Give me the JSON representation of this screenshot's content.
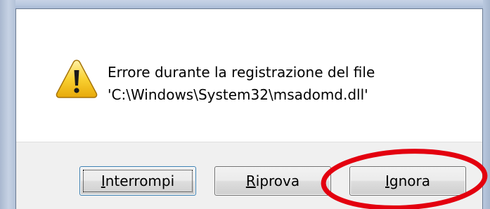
{
  "dialog": {
    "message_line1": "Errore durante la registrazione del file",
    "message_line2": "'C:\\Windows\\System32\\msadomd.dll'",
    "icon": "warning-icon"
  },
  "buttons": {
    "interrompi": {
      "accel": "I",
      "rest": "nterrompi",
      "label": "Interrompi"
    },
    "riprova": {
      "accel": "R",
      "rest": "iprova",
      "label": "Riprova"
    },
    "ignora": {
      "accel": "I",
      "rest": "gnora",
      "label": "Ignora"
    }
  },
  "annotation": {
    "type": "red-circle",
    "color": "#e3000f",
    "target": "ignora-button"
  }
}
